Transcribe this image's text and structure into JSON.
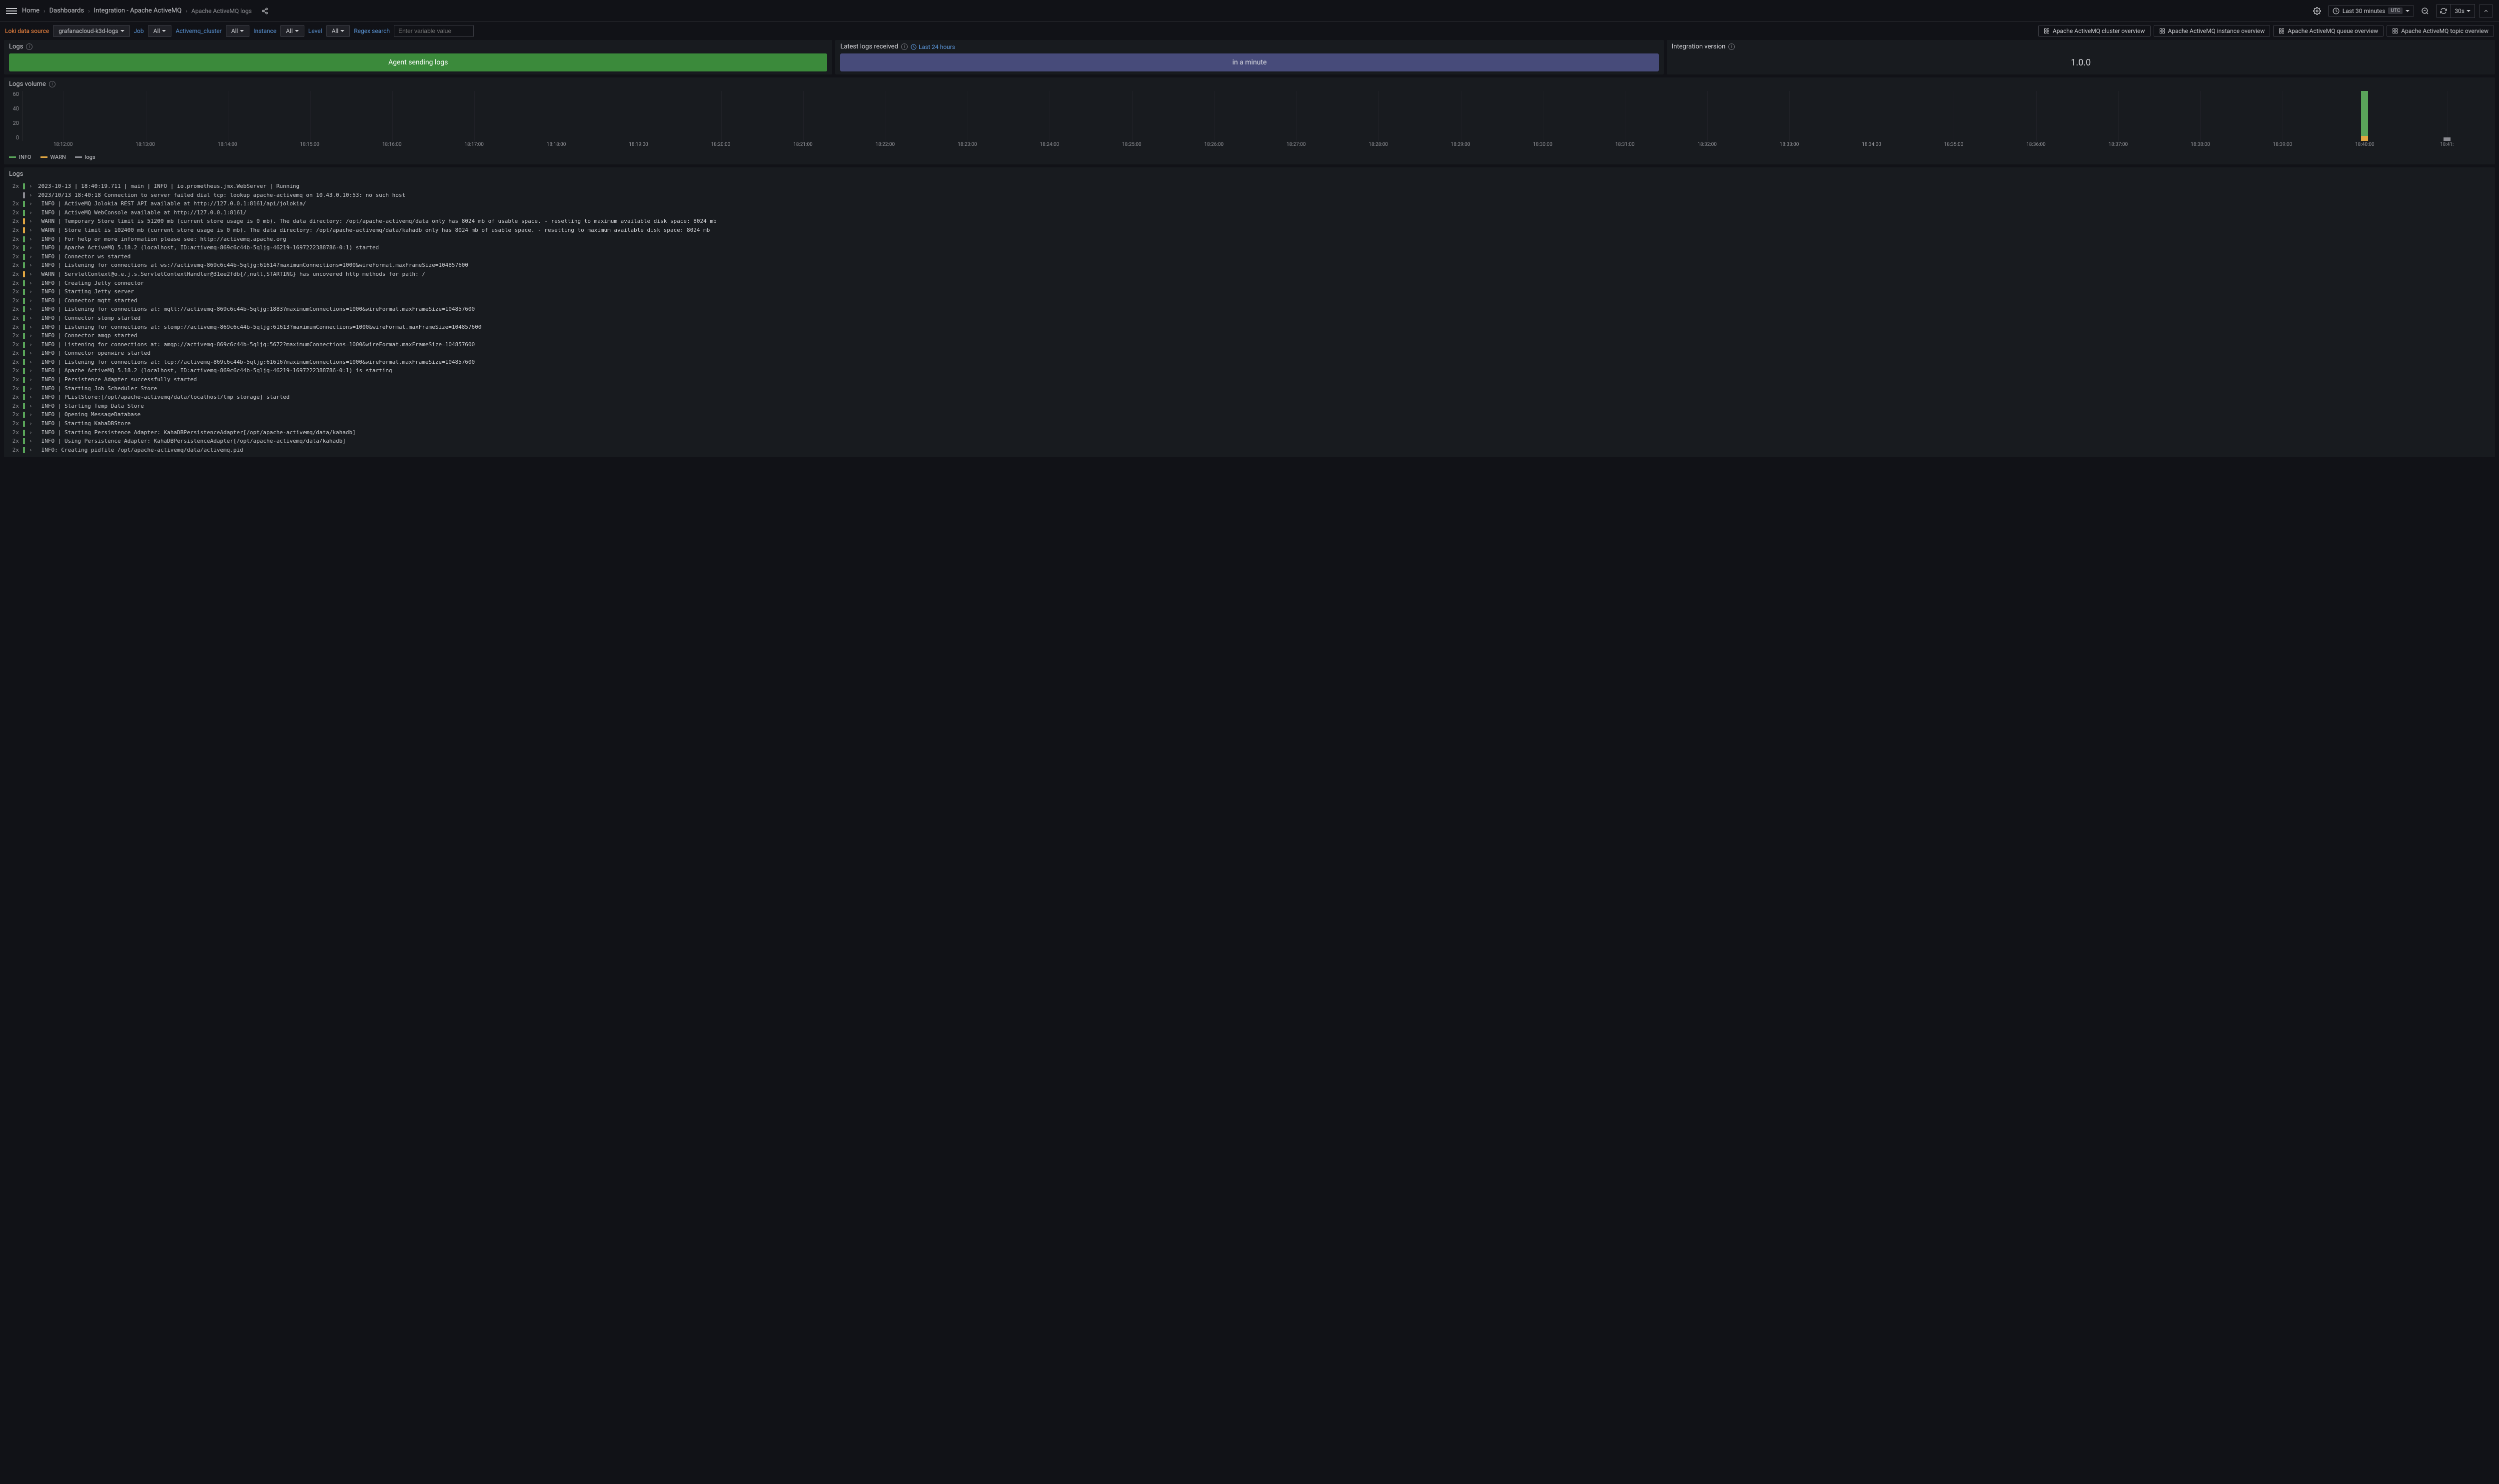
{
  "breadcrumbs": [
    "Home",
    "Dashboards",
    "Integration - Apache ActiveMQ",
    "Apache ActiveMQ logs"
  ],
  "time_range": "Last 30 minutes",
  "timezone": "UTC",
  "refresh": "30s",
  "controls": {
    "datasource_label": "Loki data source",
    "datasource_value": "grafanacloud-k3d-logs",
    "job_label": "Job",
    "job_value": "All",
    "cluster_label": "Activemq_cluster",
    "cluster_value": "All",
    "instance_label": "Instance",
    "instance_value": "All",
    "level_label": "Level",
    "level_value": "All",
    "regex_label": "Regex search",
    "regex_placeholder": "Enter variable value"
  },
  "links": [
    "Apache ActiveMQ cluster overview",
    "Apache ActiveMQ instance overview",
    "Apache ActiveMQ queue overview",
    "Apache ActiveMQ topic overview"
  ],
  "stats": {
    "logs_title": "Logs",
    "logs_value": "Agent sending logs",
    "latest_title": "Latest logs received",
    "latest_link": "Last 24 hours",
    "latest_value": "in a minute",
    "version_title": "Integration version",
    "version_value": "1.0.0"
  },
  "volume": {
    "title": "Logs volume",
    "legend": [
      "INFO",
      "WARN",
      "logs"
    ]
  },
  "chart_data": {
    "type": "bar",
    "ylabel": "",
    "ylim": [
      0,
      60
    ],
    "yticks": [
      60,
      40,
      20,
      0
    ],
    "categories": [
      "18:12:00",
      "18:13:00",
      "18:14:00",
      "18:15:00",
      "18:16:00",
      "18:17:00",
      "18:18:00",
      "18:19:00",
      "18:20:00",
      "18:21:00",
      "18:22:00",
      "18:23:00",
      "18:24:00",
      "18:25:00",
      "18:26:00",
      "18:27:00",
      "18:28:00",
      "18:29:00",
      "18:30:00",
      "18:31:00",
      "18:32:00",
      "18:33:00",
      "18:34:00",
      "18:35:00",
      "18:36:00",
      "18:37:00",
      "18:38:00",
      "18:39:00",
      "18:40:00",
      "18:41:"
    ],
    "series": [
      {
        "name": "INFO",
        "color": "#5aa55a",
        "values": [
          0,
          0,
          0,
          0,
          0,
          0,
          0,
          0,
          0,
          0,
          0,
          0,
          0,
          0,
          0,
          0,
          0,
          0,
          0,
          0,
          0,
          0,
          0,
          0,
          0,
          0,
          0,
          0,
          54,
          0
        ]
      },
      {
        "name": "WARN",
        "color": "#e0a642",
        "values": [
          0,
          0,
          0,
          0,
          0,
          0,
          0,
          0,
          0,
          0,
          0,
          0,
          0,
          0,
          0,
          0,
          0,
          0,
          0,
          0,
          0,
          0,
          0,
          0,
          0,
          0,
          0,
          0,
          6,
          0
        ]
      },
      {
        "name": "logs",
        "color": "#8a8b91",
        "values": [
          0,
          0,
          0,
          0,
          0,
          0,
          0,
          0,
          0,
          0,
          0,
          0,
          0,
          0,
          0,
          0,
          0,
          0,
          0,
          0,
          0,
          0,
          0,
          0,
          0,
          0,
          0,
          0,
          0,
          4
        ]
      }
    ]
  },
  "logs_title": "Logs",
  "colors": {
    "info": "#5aa55a",
    "warn": "#e0a642",
    "logs": "#8a8b91"
  },
  "log_lines": [
    {
      "count": "2x",
      "lvl": "info",
      "msg": "2023-10-13 | 18:40:19.711 | main | INFO | io.prometheus.jmx.WebServer | Running"
    },
    {
      "count": "",
      "lvl": "logs",
      "msg": "2023/10/13 18:40:18 Connection to server failed dial tcp: lookup apache-activemq on 10.43.0.10:53: no such host"
    },
    {
      "count": "2x",
      "lvl": "info",
      "msg": " INFO | ActiveMQ Jolokia REST API available at http://127.0.0.1:8161/api/jolokia/"
    },
    {
      "count": "2x",
      "lvl": "info",
      "msg": " INFO | ActiveMQ WebConsole available at http://127.0.0.1:8161/"
    },
    {
      "count": "2x",
      "lvl": "warn",
      "msg": " WARN | Temporary Store limit is 51200 mb (current store usage is 0 mb). The data directory: /opt/apache-activemq/data only has 8024 mb of usable space. - resetting to maximum available disk space: 8024 mb"
    },
    {
      "count": "2x",
      "lvl": "warn",
      "msg": " WARN | Store limit is 102400 mb (current store usage is 0 mb). The data directory: /opt/apache-activemq/data/kahadb only has 8024 mb of usable space. - resetting to maximum available disk space: 8024 mb"
    },
    {
      "count": "2x",
      "lvl": "info",
      "msg": " INFO | For help or more information please see: http://activemq.apache.org"
    },
    {
      "count": "2x",
      "lvl": "info",
      "msg": " INFO | Apache ActiveMQ 5.18.2 (localhost, ID:activemq-869c6c44b-5qljg-46219-1697222388786-0:1) started"
    },
    {
      "count": "2x",
      "lvl": "info",
      "msg": " INFO | Connector ws started"
    },
    {
      "count": "2x",
      "lvl": "info",
      "msg": " INFO | Listening for connections at ws://activemq-869c6c44b-5qljg:61614?maximumConnections=1000&wireFormat.maxFrameSize=104857600"
    },
    {
      "count": "2x",
      "lvl": "warn",
      "msg": " WARN | ServletContext@o.e.j.s.ServletContextHandler@31ee2fdb{/,null,STARTING} has uncovered http methods for path: /"
    },
    {
      "count": "2x",
      "lvl": "info",
      "msg": " INFO | Creating Jetty connector"
    },
    {
      "count": "2x",
      "lvl": "info",
      "msg": " INFO | Starting Jetty server"
    },
    {
      "count": "2x",
      "lvl": "info",
      "msg": " INFO | Connector mqtt started"
    },
    {
      "count": "2x",
      "lvl": "info",
      "msg": " INFO | Listening for connections at: mqtt://activemq-869c6c44b-5qljg:1883?maximumConnections=1000&wireFormat.maxFrameSize=104857600"
    },
    {
      "count": "2x",
      "lvl": "info",
      "msg": " INFO | Connector stomp started"
    },
    {
      "count": "2x",
      "lvl": "info",
      "msg": " INFO | Listening for connections at: stomp://activemq-869c6c44b-5qljg:61613?maximumConnections=1000&wireFormat.maxFrameSize=104857600"
    },
    {
      "count": "2x",
      "lvl": "info",
      "msg": " INFO | Connector amqp started"
    },
    {
      "count": "2x",
      "lvl": "info",
      "msg": " INFO | Listening for connections at: amqp://activemq-869c6c44b-5qljg:5672?maximumConnections=1000&wireFormat.maxFrameSize=104857600"
    },
    {
      "count": "2x",
      "lvl": "info",
      "msg": " INFO | Connector openwire started"
    },
    {
      "count": "2x",
      "lvl": "info",
      "msg": " INFO | Listening for connections at: tcp://activemq-869c6c44b-5qljg:61616?maximumConnections=1000&wireFormat.maxFrameSize=104857600"
    },
    {
      "count": "2x",
      "lvl": "info",
      "msg": " INFO | Apache ActiveMQ 5.18.2 (localhost, ID:activemq-869c6c44b-5qljg-46219-1697222388786-0:1) is starting"
    },
    {
      "count": "2x",
      "lvl": "info",
      "msg": " INFO | Persistence Adapter successfully started"
    },
    {
      "count": "2x",
      "lvl": "info",
      "msg": " INFO | Starting Job Scheduler Store"
    },
    {
      "count": "2x",
      "lvl": "info",
      "msg": " INFO | PListStore:[/opt/apache-activemq/data/localhost/tmp_storage] started"
    },
    {
      "count": "2x",
      "lvl": "info",
      "msg": " INFO | Starting Temp Data Store"
    },
    {
      "count": "2x",
      "lvl": "info",
      "msg": " INFO | Opening MessageDatabase"
    },
    {
      "count": "2x",
      "lvl": "info",
      "msg": " INFO | Starting KahaDBStore"
    },
    {
      "count": "2x",
      "lvl": "info",
      "msg": " INFO | Starting Persistence Adapter: KahaDBPersistenceAdapter[/opt/apache-activemq/data/kahadb]"
    },
    {
      "count": "2x",
      "lvl": "info",
      "msg": " INFO | Using Persistence Adapter: KahaDBPersistenceAdapter[/opt/apache-activemq/data/kahadb]"
    },
    {
      "count": "2x",
      "lvl": "info",
      "msg": " INFO: Creating pidfile /opt/apache-activemq/data/activemq.pid"
    }
  ]
}
